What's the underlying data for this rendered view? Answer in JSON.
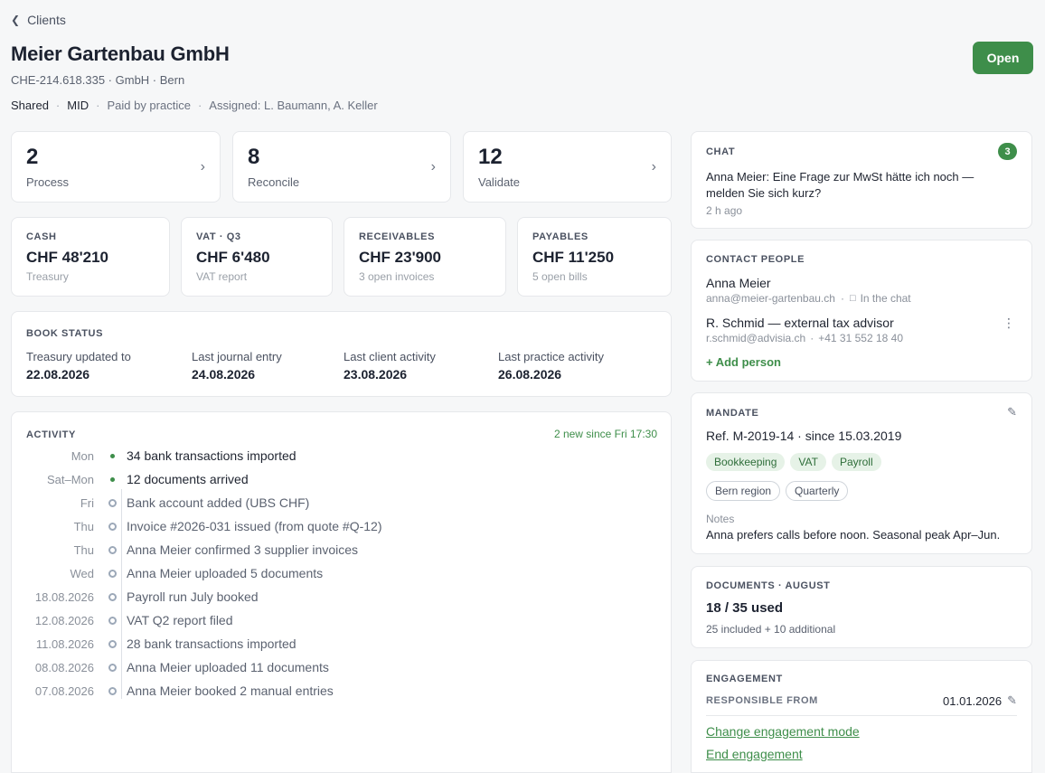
{
  "header": {
    "back_label": "Clients",
    "title": "Meier Gartenbau GmbH",
    "subtitle": "CHE-214.618.335 · GmbH · Bern",
    "meta": [
      "Shared",
      "MID",
      "Paid by practice",
      "Assigned: L. Baumann, A. Keller"
    ],
    "open_button": "Open"
  },
  "metrics": [
    {
      "value": "2",
      "label": "Process"
    },
    {
      "value": "8",
      "label": "Reconcile"
    },
    {
      "value": "12",
      "label": "Validate"
    }
  ],
  "kpis": [
    {
      "caption": "CASH",
      "value": "CHF 48'210",
      "sub": "Treasury"
    },
    {
      "caption": "VAT · Q3",
      "value": "CHF 6'480",
      "sub": "VAT report"
    },
    {
      "caption": "RECEIVABLES",
      "value": "CHF 23'900",
      "sub": "3 open invoices"
    },
    {
      "caption": "PAYABLES",
      "value": "CHF 11'250",
      "sub": "5 open bills"
    }
  ],
  "book_status": {
    "caption": "BOOK STATUS",
    "items": [
      {
        "label": "Treasury updated to",
        "value": "22.08.2026"
      },
      {
        "label": "Last journal entry",
        "value": "24.08.2026"
      },
      {
        "label": "Last client activity",
        "value": "23.08.2026"
      },
      {
        "label": "Last practice activity",
        "value": "26.08.2026"
      }
    ]
  },
  "activity": {
    "caption": "ACTIVITY",
    "new_since": "2 new since Fri 17:30",
    "items": [
      {
        "date": "Mon",
        "text": "34 bank transactions imported",
        "is_new": true
      },
      {
        "date": "Sat–Mon",
        "text": "12 documents arrived",
        "is_new": true
      },
      {
        "date": "Fri",
        "text": "Bank account added (UBS CHF)",
        "is_new": false
      },
      {
        "date": "Thu",
        "text": "Invoice #2026-031 issued (from quote #Q-12)",
        "is_new": false
      },
      {
        "date": "Thu",
        "text": "Anna Meier confirmed 3 supplier invoices",
        "is_new": false
      },
      {
        "date": "Wed",
        "text": "Anna Meier uploaded 5 documents",
        "is_new": false
      },
      {
        "date": "18.08.2026",
        "text": "Payroll run July booked",
        "is_new": false
      },
      {
        "date": "12.08.2026",
        "text": "VAT Q2 report filed",
        "is_new": false
      },
      {
        "date": "11.08.2026",
        "text": "28 bank transactions imported",
        "is_new": false
      },
      {
        "date": "08.08.2026",
        "text": "Anna Meier uploaded 11 documents",
        "is_new": false
      },
      {
        "date": "07.08.2026",
        "text": "Anna Meier booked 2 manual entries",
        "is_new": false
      }
    ]
  },
  "chat": {
    "caption": "CHAT",
    "badge": "3",
    "message": "Anna Meier: Eine Frage zur MwSt hätte ich noch — melden Sie sich kurz?",
    "time": "2 h ago"
  },
  "contacts": {
    "caption": "CONTACT PEOPLE",
    "people": [
      {
        "name": "Anna Meier",
        "email": "anna@meier-gartenbau.ch",
        "extra": "In the chat"
      },
      {
        "name": "R. Schmid — external tax advisor",
        "email": "r.schmid@advisia.ch",
        "extra": "+41 31 552 18 40"
      }
    ],
    "add_label": "+ Add person"
  },
  "mandate": {
    "caption": "MANDATE",
    "ref": "Ref. M-2019-14 · since 15.03.2019",
    "services": [
      "Bookkeeping",
      "VAT",
      "Payroll"
    ],
    "tags": [
      "Bern region",
      "Quarterly"
    ],
    "notes_label": "Notes",
    "notes": "Anna prefers calls before noon. Seasonal peak Apr–Jun."
  },
  "documents": {
    "caption": "DOCUMENTS · AUGUST",
    "used": "18 / 35 used",
    "detail": "25 included + 10 additional"
  },
  "engagement": {
    "caption": "ENGAGEMENT",
    "responsible_label": "RESPONSIBLE FROM",
    "responsible_date": "01.01.2026",
    "change_label": "Change engagement mode",
    "end_label": "End engagement"
  },
  "colors": {
    "accent": "#3e8e4a",
    "background": "#f6f7f8",
    "card": "#ffffff"
  }
}
